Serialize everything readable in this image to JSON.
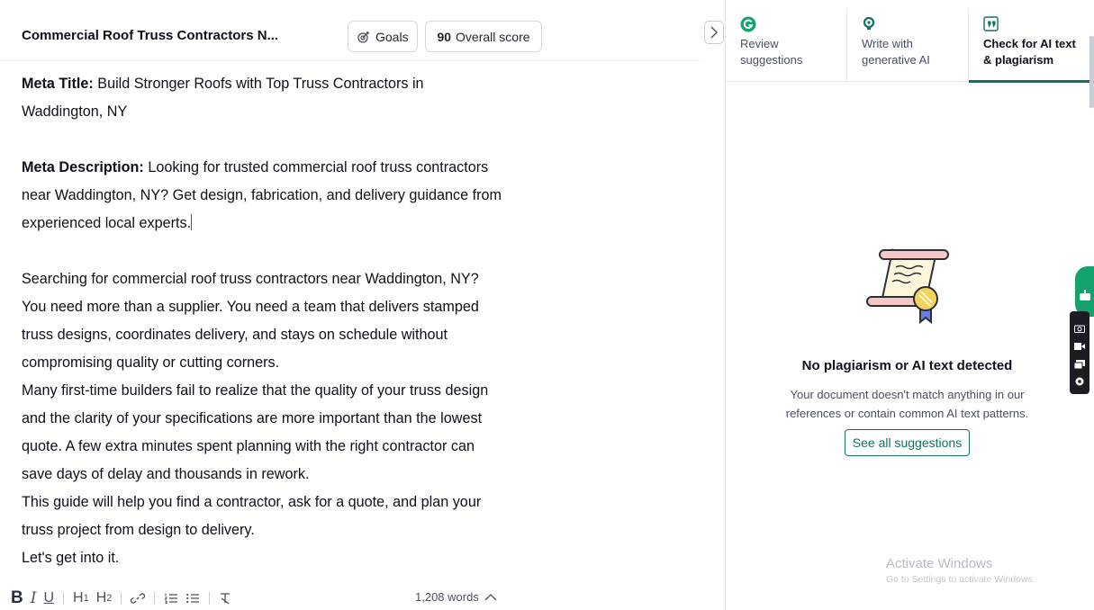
{
  "header": {
    "doc_title": "Commercial Roof Truss Contractors N...",
    "goals_label": "Goals",
    "score_value": "90",
    "score_label": "Overall score"
  },
  "editor": {
    "meta_title_label": "Meta Title:",
    "meta_title_line1": "Build Stronger Roofs with Top Truss Contractors in",
    "meta_title_line2": "Waddington, NY",
    "meta_desc_label": "Meta Description:",
    "meta_desc_line1": "Looking for trusted commercial roof truss contractors",
    "meta_desc_line2": "near Waddington, NY? Get design, fabrication, and delivery guidance from",
    "meta_desc_line3": "experienced local experts.",
    "lines": [
      "Searching for commercial roof truss contractors near Waddington, NY?",
      "You need more than a supplier. You need a team that delivers stamped",
      "truss designs, coordinates delivery, and stays on schedule without",
      "compromising quality or cutting corners.",
      "Many first-time builders fail to realize that the quality of your truss design",
      "and the clarity of your specifications are more important than the lowest",
      "quote. A few extra minutes spent planning with the right contractor can",
      "save days of delay and thousands in rework.",
      "This guide will help you find a contractor, ask for a quote, and plan your",
      "truss project from design to delivery.",
      "Let's get into it."
    ]
  },
  "toolbar": {
    "bold": "B",
    "italic": "I",
    "underline": "U",
    "h1": "H",
    "h1_sub": "1",
    "h2": "H",
    "h2_sub": "2",
    "word_count": "1,208 words"
  },
  "panel": {
    "tabs": [
      {
        "label": "Review suggestions",
        "icon": "grammarly-logo-icon"
      },
      {
        "label": "Write with generative AI",
        "icon": "lightbulb-icon"
      },
      {
        "label": "Check for AI text & plagiarism",
        "icon": "quote-icon"
      }
    ],
    "empty_title": "No plagiarism or AI text detected",
    "empty_desc": "Your document doesn't match anything in our references or contain common AI text patterns.",
    "see_all_label": "See all suggestions"
  },
  "watermark": {
    "line1": "Activate Windows",
    "line2": "Go to Settings to activate Windows."
  },
  "colors": {
    "accent": "#107260",
    "brand_green": "#15a36d",
    "text": "#0e101a",
    "muted": "#4a5060"
  }
}
